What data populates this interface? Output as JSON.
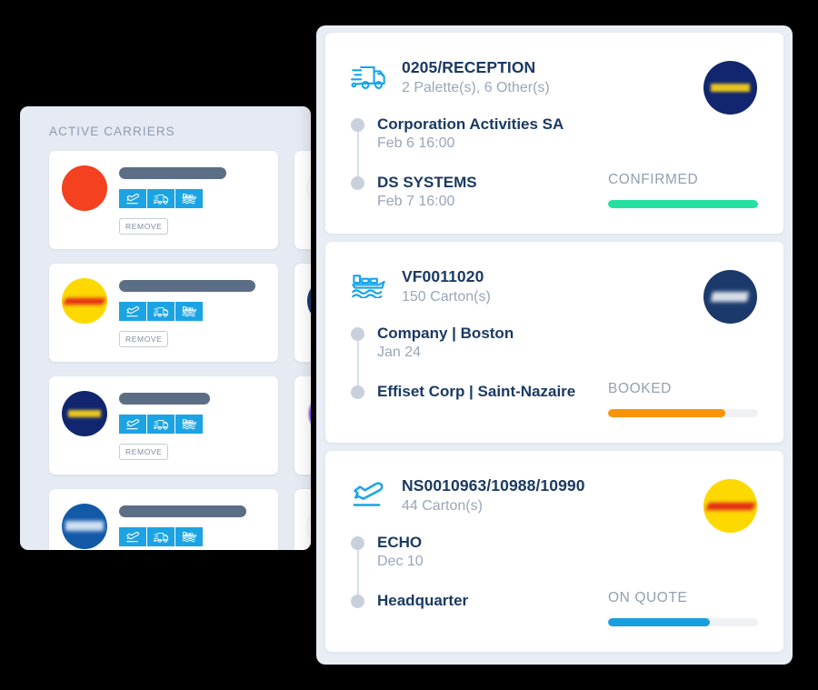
{
  "colors": {
    "background": "#000000",
    "panel_bg": "#e6eaf2",
    "card_bg": "#ffffff",
    "accent_blue": "#16a4e8",
    "mode_btn_blue": "#1ca3e3",
    "title_navy": "#1b3a63",
    "muted_grey": "#9aa6b8",
    "status_confirmed": "#25e0a0",
    "status_booked": "#f89406",
    "status_on_quote": "#199fdd",
    "track_grey": "#eff1f5"
  },
  "carriers_panel": {
    "title": "ACTIVE CARRIERS",
    "remove_label": "REMOVE",
    "mode_icons": [
      "plane-icon",
      "truck-icon",
      "ship-icon"
    ],
    "items": [
      {
        "logo": "logo-red",
        "logo_name": "carrier-logo-red",
        "name_bar_width": 118,
        "has_remove": true
      },
      {
        "logo": "logo-mits",
        "logo_name": "carrier-logo-mitsui",
        "name_bar_width": 110,
        "has_remove": true
      },
      {
        "logo": "logo-dhl",
        "logo_name": "carrier-logo-dhl",
        "name_bar_width": 150,
        "has_remove": true
      },
      {
        "logo": "logo-dsv",
        "logo_name": "carrier-logo-dsv",
        "name_bar_width": 132,
        "has_remove": true
      },
      {
        "logo": "logo-gefco",
        "logo_name": "carrier-logo-gefco",
        "name_bar_width": 100,
        "has_remove": true
      },
      {
        "logo": "logo-purple",
        "logo_name": "carrier-logo-purple",
        "name_bar_width": 126,
        "has_remove": true
      },
      {
        "logo": "logo-kuehne",
        "logo_name": "carrier-logo-kuehne",
        "name_bar_width": 140,
        "has_remove": true
      },
      {
        "logo": "logo-lufthansa",
        "logo_name": "carrier-logo-lufthansa",
        "name_bar_width": 118,
        "has_remove": true
      }
    ]
  },
  "shipments": {
    "cards": [
      {
        "mode": "truck",
        "mode_icon": "truck-icon",
        "reference": "0205/RECEPTION",
        "quantity": "2 Palette(s), 6 Other(s)",
        "carrier_logo": "logo-gefco",
        "carrier_logo_name": "carrier-avatar-gefco",
        "origin": {
          "name": "Corporation Activities SA",
          "date": "Feb 6 16:00"
        },
        "destination": {
          "name": "DS SYSTEMS",
          "date": "Feb 7 16:00"
        },
        "status": "CONFIRMED",
        "progress": 100,
        "progress_color": "#25e0a0"
      },
      {
        "mode": "ship",
        "mode_icon": "ship-icon",
        "reference": "VF0011020",
        "quantity": "150 Carton(s)",
        "carrier_logo": "logo-dsv",
        "carrier_logo_name": "carrier-avatar-dsv",
        "origin": {
          "name": "Company | Boston",
          "date": "Jan 24"
        },
        "destination": {
          "name": "Effiset Corp | Saint-Nazaire",
          "date": ""
        },
        "status": "BOOKED",
        "progress": 78,
        "progress_color": "#f89406"
      },
      {
        "mode": "plane",
        "mode_icon": "plane-icon",
        "reference": "NS0010963/10988/10990",
        "quantity": "44 Carton(s)",
        "carrier_logo": "logo-dhl",
        "carrier_logo_name": "carrier-avatar-dhl",
        "origin": {
          "name": "ECHO",
          "date": "Dec 10"
        },
        "destination": {
          "name": "Headquarter",
          "date": ""
        },
        "status": "ON QUOTE",
        "progress": 68,
        "progress_color": "#199fdd"
      }
    ]
  }
}
